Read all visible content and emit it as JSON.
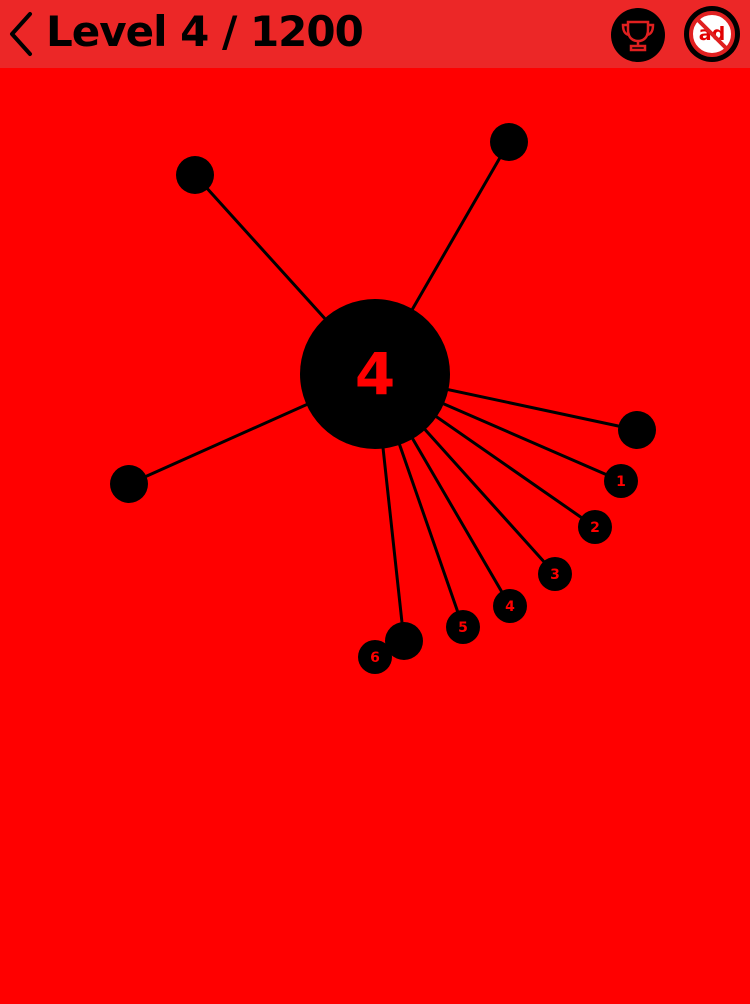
{
  "header": {
    "title": "Level 4 / 1200",
    "back_icon": "chevron-left-icon",
    "trophy_icon": "trophy-icon",
    "noad_icon": "no-ads-icon",
    "noad_label": "ad"
  },
  "game": {
    "level_number": "4",
    "background_color": "#ff0000",
    "header_color": "#ec2727",
    "pin_color": "#000000",
    "placed_pins_count": 5,
    "waiting_pins": [
      "1",
      "2",
      "3",
      "4",
      "5",
      "6"
    ]
  }
}
